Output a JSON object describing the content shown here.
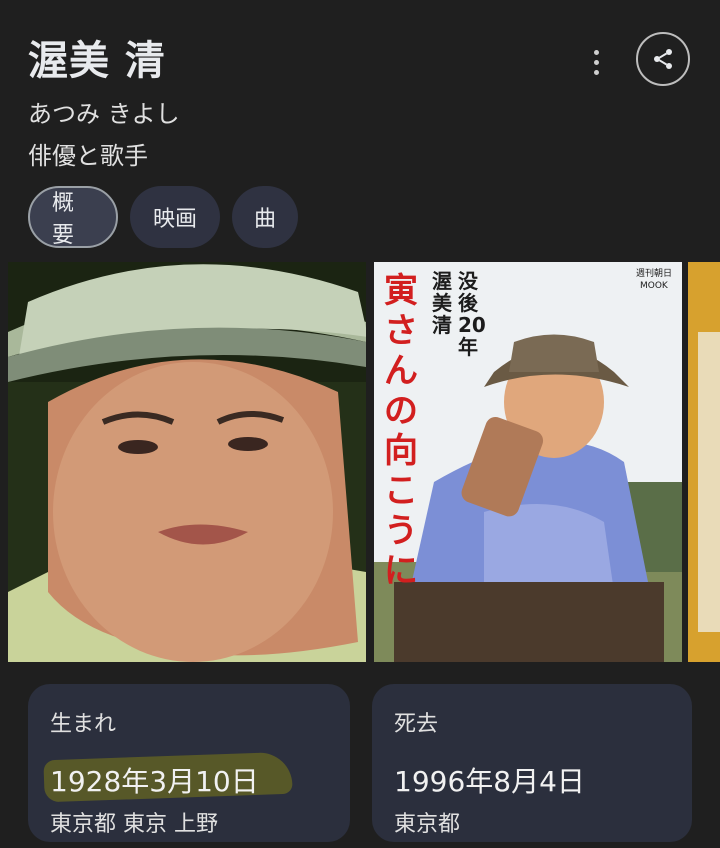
{
  "header": {
    "title": "渥美 清",
    "reading": "あつみ きよし",
    "description": "俳優と歌手"
  },
  "tabs": [
    {
      "label": "概要"
    },
    {
      "label": "映画"
    },
    {
      "label": "曲"
    }
  ],
  "images": {
    "book_cover": {
      "title_vertical": "寅さんの向こうに",
      "subtitle": "渥美清 没後20年",
      "publisher": "週刊朝日 MOOK"
    }
  },
  "facts": {
    "born": {
      "label": "生まれ",
      "date": "1928年3月10日",
      "place": "東京都 東京 上野"
    },
    "died": {
      "label": "死去",
      "date": "1996年8月4日",
      "place": "東京都"
    }
  },
  "colors": {
    "background": "#1f1f1f",
    "card": "#2b2f3d",
    "highlight": "#7c7a18"
  }
}
